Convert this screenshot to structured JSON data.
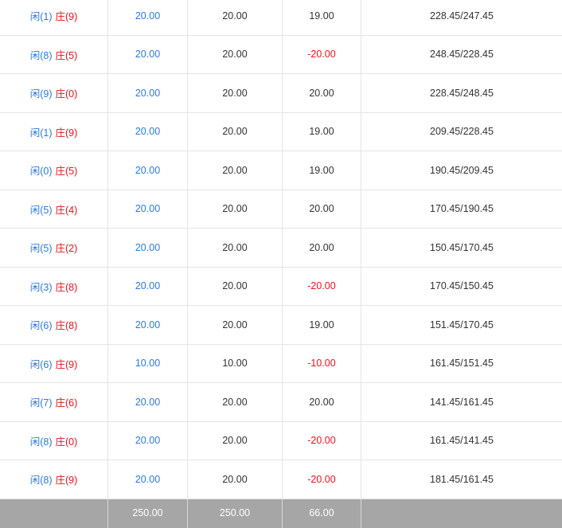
{
  "rows": [
    {
      "player": "闲(1)",
      "banker": "庄(9)",
      "bet": "20.00",
      "valid": "20.00",
      "winloss": "19.00",
      "wl_color": "dark",
      "balance": "228.45/247.45"
    },
    {
      "player": "闲(8)",
      "banker": "庄(5)",
      "bet": "20.00",
      "valid": "20.00",
      "winloss": "-20.00",
      "wl_color": "red",
      "balance": "248.45/228.45"
    },
    {
      "player": "闲(9)",
      "banker": "庄(0)",
      "bet": "20.00",
      "valid": "20.00",
      "winloss": "20.00",
      "wl_color": "dark",
      "balance": "228.45/248.45"
    },
    {
      "player": "闲(1)",
      "banker": "庄(9)",
      "bet": "20.00",
      "valid": "20.00",
      "winloss": "19.00",
      "wl_color": "dark",
      "balance": "209.45/228.45"
    },
    {
      "player": "闲(0)",
      "banker": "庄(5)",
      "bet": "20.00",
      "valid": "20.00",
      "winloss": "19.00",
      "wl_color": "dark",
      "balance": "190.45/209.45"
    },
    {
      "player": "闲(5)",
      "banker": "庄(4)",
      "bet": "20.00",
      "valid": "20.00",
      "winloss": "20.00",
      "wl_color": "dark",
      "balance": "170.45/190.45"
    },
    {
      "player": "闲(5)",
      "banker": "庄(2)",
      "bet": "20.00",
      "valid": "20.00",
      "winloss": "20.00",
      "wl_color": "dark",
      "balance": "150.45/170.45"
    },
    {
      "player": "闲(3)",
      "banker": "庄(8)",
      "bet": "20.00",
      "valid": "20.00",
      "winloss": "-20.00",
      "wl_color": "red",
      "balance": "170.45/150.45"
    },
    {
      "player": "闲(6)",
      "banker": "庄(8)",
      "bet": "20.00",
      "valid": "20.00",
      "winloss": "19.00",
      "wl_color": "dark",
      "balance": "151.45/170.45"
    },
    {
      "player": "闲(6)",
      "banker": "庄(9)",
      "bet": "10.00",
      "valid": "10.00",
      "winloss": "-10.00",
      "wl_color": "red",
      "balance": "161.45/151.45"
    },
    {
      "player": "闲(7)",
      "banker": "庄(6)",
      "bet": "20.00",
      "valid": "20.00",
      "winloss": "20.00",
      "wl_color": "dark",
      "balance": "141.45/161.45"
    },
    {
      "player": "闲(8)",
      "banker": "庄(0)",
      "bet": "20.00",
      "valid": "20.00",
      "winloss": "-20.00",
      "wl_color": "red",
      "balance": "161.45/141.45"
    },
    {
      "player": "闲(8)",
      "banker": "庄(9)",
      "bet": "20.00",
      "valid": "20.00",
      "winloss": "-20.00",
      "wl_color": "red",
      "balance": "181.45/161.45"
    }
  ],
  "totals": {
    "bet": "250.00",
    "valid": "250.00",
    "winloss": "66.00"
  },
  "colors": {
    "player": "#2a7ae2",
    "banker": "#e8131e",
    "footer_bg": "#a6a6a6"
  }
}
